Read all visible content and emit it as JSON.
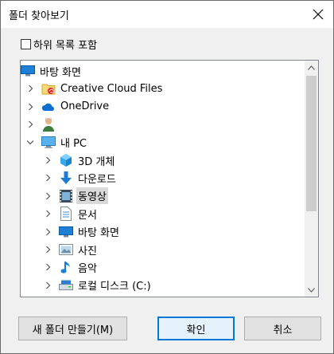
{
  "window": {
    "title": "폴더 찾아보기"
  },
  "options": {
    "include_subfolders_label": "하위 목록 포함",
    "include_subfolders_checked": false
  },
  "tree": {
    "items": [
      {
        "label": "바탕 화면",
        "icon": "desktop-icon",
        "level": 0,
        "expander": "none",
        "selected": false
      },
      {
        "label": "Creative Cloud Files",
        "icon": "creative-cloud-folder-icon",
        "level": 1,
        "expander": "collapsed",
        "selected": false
      },
      {
        "label": "OneDrive",
        "icon": "onedrive-cloud-icon",
        "level": 1,
        "expander": "collapsed",
        "selected": false
      },
      {
        "label": "",
        "icon": "user-icon",
        "level": 1,
        "expander": "collapsed",
        "selected": false
      },
      {
        "label": "내 PC",
        "icon": "this-pc-icon",
        "level": 1,
        "expander": "expanded",
        "selected": false
      },
      {
        "label": "3D 개체",
        "icon": "3d-objects-icon",
        "level": 2,
        "expander": "collapsed",
        "selected": false
      },
      {
        "label": "다운로드",
        "icon": "downloads-icon",
        "level": 2,
        "expander": "collapsed",
        "selected": false
      },
      {
        "label": "동영상",
        "icon": "videos-icon",
        "level": 2,
        "expander": "collapsed",
        "selected": true
      },
      {
        "label": "문서",
        "icon": "documents-icon",
        "level": 2,
        "expander": "collapsed",
        "selected": false
      },
      {
        "label": "바탕 화면",
        "icon": "desktop-icon",
        "level": 2,
        "expander": "collapsed",
        "selected": false
      },
      {
        "label": "사진",
        "icon": "pictures-icon",
        "level": 2,
        "expander": "collapsed",
        "selected": false
      },
      {
        "label": "음악",
        "icon": "music-icon",
        "level": 2,
        "expander": "collapsed",
        "selected": false
      },
      {
        "label": "로컬 디스크 (C:)",
        "icon": "local-disk-icon",
        "level": 2,
        "expander": "collapsed",
        "selected": false
      }
    ]
  },
  "buttons": {
    "new_folder": "새 폴더 만들기(M)",
    "ok": "확인",
    "cancel": "취소"
  },
  "colors": {
    "accent": "#0078d7",
    "selection": "#d9d9d9",
    "folder": "#f8d775"
  }
}
